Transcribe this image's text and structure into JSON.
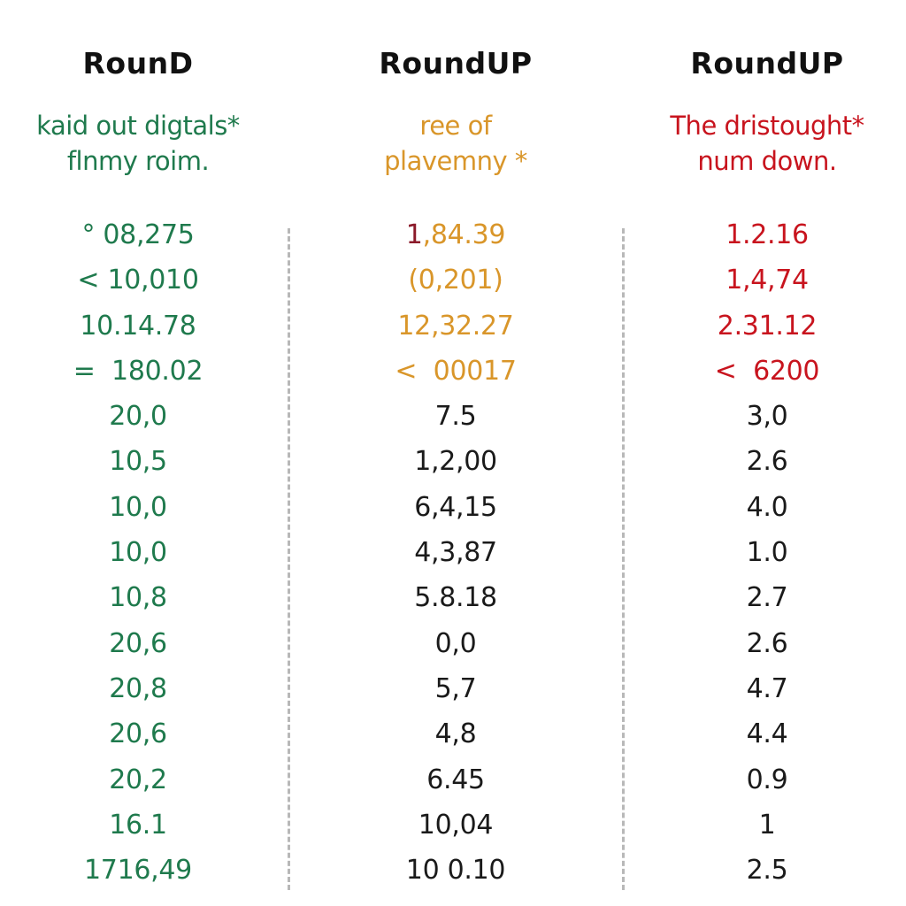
{
  "colors": {
    "heading": "#111111",
    "green": "#1f7a4d",
    "amber": "#d9962a",
    "red": "#c8141e",
    "dark_red": "#8b1a2a",
    "black": "#1a1a1a",
    "divider": "#b8b8b8"
  },
  "columns": [
    {
      "heading": "RounD",
      "description_lines": [
        "kaid out digtals*",
        "flnmy roim."
      ],
      "description_color": "#1f7a4d",
      "rows": [
        {
          "text": "° 08,275",
          "color": "#1f7a4d"
        },
        {
          "text": "< 10,010",
          "color": "#1f7a4d"
        },
        {
          "text": "10.14.78",
          "color": "#1f7a4d"
        },
        {
          "text": "=  180.02",
          "color": "#1f7a4d"
        },
        {
          "text": "20,0",
          "color": "#1f7a4d"
        },
        {
          "text": "10,5",
          "color": "#1f7a4d"
        },
        {
          "text": "10,0",
          "color": "#1f7a4d"
        },
        {
          "text": "10,0",
          "color": "#1f7a4d"
        },
        {
          "text": "10,8",
          "color": "#1f7a4d"
        },
        {
          "text": "20,6",
          "color": "#1f7a4d"
        },
        {
          "text": "20,8",
          "color": "#1f7a4d"
        },
        {
          "text": "20,6",
          "color": "#1f7a4d"
        },
        {
          "text": "20,2",
          "color": "#1f7a4d"
        },
        {
          "text": "16.1",
          "color": "#1f7a4d"
        },
        {
          "text": "1716,49",
          "color": "#1f7a4d"
        }
      ]
    },
    {
      "heading": "RoundUP",
      "description_lines": [
        "ree of",
        "plavemny *"
      ],
      "description_color": "#d9962a",
      "rows": [
        {
          "text": ",84.39",
          "prefix": "1",
          "prefix_color": "#8b1a2a",
          "color": "#d9962a"
        },
        {
          "text": "(0,201)",
          "color": "#d9962a"
        },
        {
          "text": "12,32.27",
          "color": "#d9962a"
        },
        {
          "text": "<  00017",
          "color": "#d9962a"
        },
        {
          "text": "7.5",
          "color": "#1a1a1a"
        },
        {
          "text": "1,2,00",
          "color": "#1a1a1a"
        },
        {
          "text": "6,4,15",
          "color": "#1a1a1a"
        },
        {
          "text": "4,3,87",
          "color": "#1a1a1a"
        },
        {
          "text": "5.8.18",
          "color": "#1a1a1a"
        },
        {
          "text": "0,0",
          "color": "#1a1a1a"
        },
        {
          "text": "5,7",
          "color": "#1a1a1a"
        },
        {
          "text": "4,8",
          "color": "#1a1a1a"
        },
        {
          "text": "6.45",
          "color": "#1a1a1a"
        },
        {
          "text": "10,04",
          "color": "#1a1a1a"
        },
        {
          "text": "10 0.10",
          "color": "#1a1a1a"
        }
      ]
    },
    {
      "heading": "RoundUP",
      "description_lines": [
        "The dristought*",
        "num down."
      ],
      "description_color": "#c8141e",
      "rows": [
        {
          "text": "1.2.16",
          "color": "#c8141e"
        },
        {
          "text": "1,4,74",
          "color": "#c8141e"
        },
        {
          "text": "2.31.12",
          "color": "#c8141e"
        },
        {
          "text": "<  6200",
          "color": "#c8141e"
        },
        {
          "text": "3,0",
          "color": "#1a1a1a"
        },
        {
          "text": "2.6",
          "color": "#1a1a1a"
        },
        {
          "text": "4.0",
          "color": "#1a1a1a"
        },
        {
          "text": "1.0",
          "color": "#1a1a1a"
        },
        {
          "text": "2.7",
          "color": "#1a1a1a"
        },
        {
          "text": "2.6",
          "color": "#1a1a1a"
        },
        {
          "text": "4.7",
          "color": "#1a1a1a"
        },
        {
          "text": "4.4",
          "color": "#1a1a1a"
        },
        {
          "text": "0.9",
          "color": "#1a1a1a"
        },
        {
          "text": "1",
          "color": "#1a1a1a"
        },
        {
          "text": "2.5",
          "color": "#1a1a1a"
        }
      ]
    }
  ]
}
